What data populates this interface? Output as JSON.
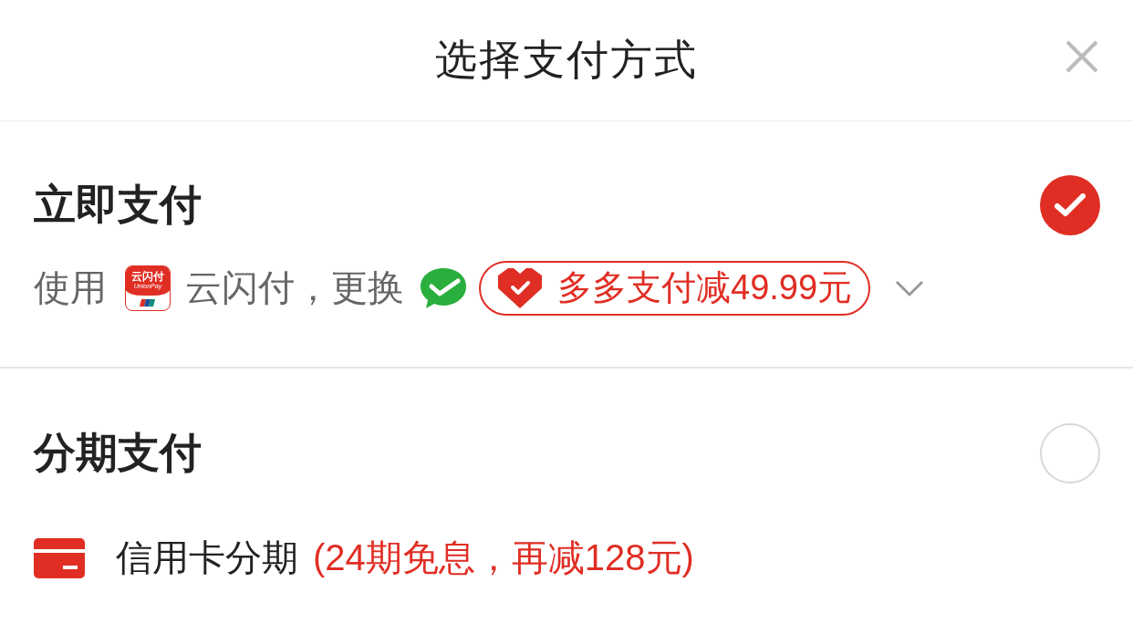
{
  "header": {
    "title": "选择支付方式"
  },
  "options": [
    {
      "kind": "instant",
      "title": "立即支付",
      "selected": true,
      "prefix": "使用",
      "logo_text": "云闪付",
      "logo_subtext": "UnionPay",
      "method": "云闪付，更换",
      "promo": "多多支付减49.99元"
    },
    {
      "kind": "installment",
      "title": "分期支付",
      "selected": false,
      "label": "信用卡分期",
      "note": "(24期免息，再减128元)"
    }
  ]
}
